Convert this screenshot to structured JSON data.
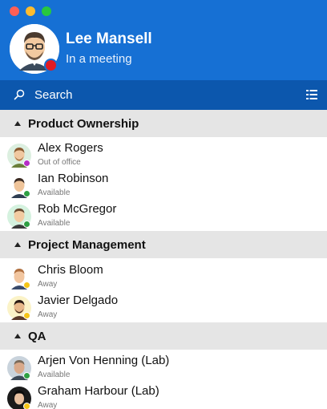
{
  "me": {
    "name": "Lee Mansell",
    "status": "In a meeting",
    "presence_color": "#e01c24"
  },
  "search": {
    "label": "Search"
  },
  "colors": {
    "header": "#1670d4",
    "searchbar": "#0c57ad",
    "group_bg": "#e5e5e5",
    "available": "#2ea043",
    "away": "#f5c518",
    "out_of_office": "#b62cc7"
  },
  "groups": [
    {
      "name": "Product Ownership",
      "contacts": [
        {
          "name": "Alex Rogers",
          "status": "Out of office",
          "presence": "out_of_office"
        },
        {
          "name": "Ian Robinson",
          "status": "Available",
          "presence": "available"
        },
        {
          "name": "Rob McGregor",
          "status": "Available",
          "presence": "available"
        }
      ]
    },
    {
      "name": "Project Management",
      "contacts": [
        {
          "name": "Chris Bloom",
          "status": "Away",
          "presence": "away"
        },
        {
          "name": "Javier Delgado",
          "status": "Away",
          "presence": "away"
        }
      ]
    },
    {
      "name": "QA",
      "contacts": [
        {
          "name": "Arjen Von Henning (Lab)",
          "status": "Available",
          "presence": "available"
        },
        {
          "name": "Graham Harbour (Lab)",
          "status": "Away",
          "presence": "away"
        }
      ]
    }
  ]
}
